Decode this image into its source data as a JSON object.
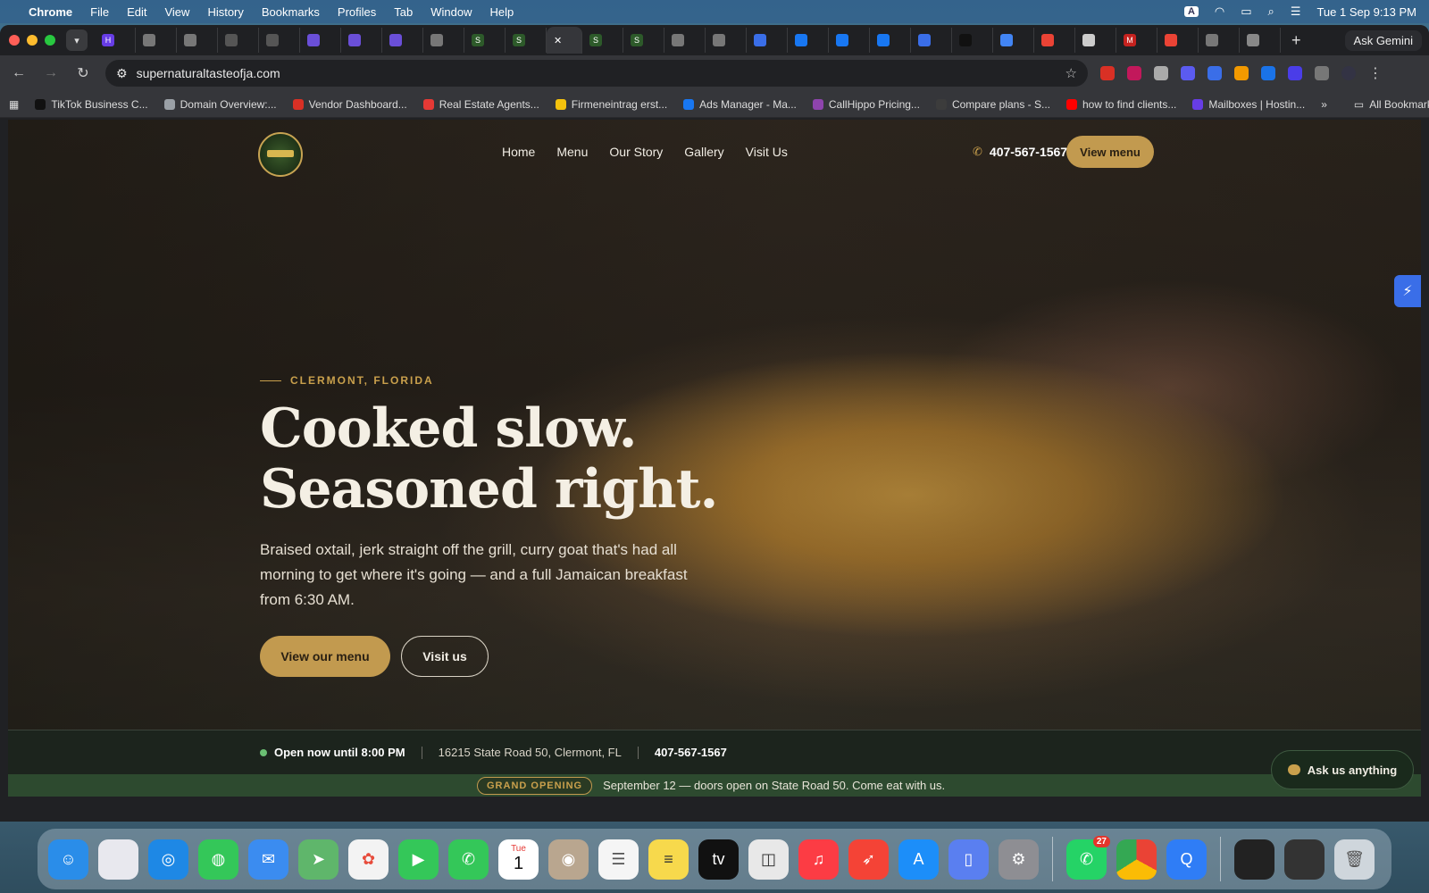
{
  "menubar": {
    "app": "Chrome",
    "items": [
      "File",
      "Edit",
      "View",
      "History",
      "Bookmarks",
      "Profiles",
      "Tab",
      "Window",
      "Help"
    ],
    "input_source": "A",
    "datetime": "Tue 1 Sep  9:13 PM"
  },
  "browser": {
    "tab_count": 30,
    "ask_gemini": "Ask Gemini",
    "url": "supernaturaltasteofja.com",
    "bookmarks": [
      {
        "label": "TikTok Business C...",
        "color": "#111111"
      },
      {
        "label": "Domain Overview:...",
        "color": "#9aa0a6"
      },
      {
        "label": "Vendor Dashboard...",
        "color": "#d93025"
      },
      {
        "label": "Real Estate Agents...",
        "color": "#e53935"
      },
      {
        "label": "Firmeneintrag erst...",
        "color": "#f4c20d"
      },
      {
        "label": "Ads Manager - Ma...",
        "color": "#1877f2"
      },
      {
        "label": "CallHippo Pricing...",
        "color": "#8e44ad"
      },
      {
        "label": "Compare plans - S...",
        "color": "#3c3c3c"
      },
      {
        "label": "how to find clients...",
        "color": "#ff0000"
      },
      {
        "label": "Mailboxes | Hostin...",
        "color": "#673de6"
      }
    ],
    "all_bookmarks": "All Bookmarks",
    "more": "»"
  },
  "site": {
    "nav": [
      "Home",
      "Menu",
      "Our Story",
      "Gallery",
      "Visit Us"
    ],
    "phone": "407-567-1567",
    "nav_cta": "View menu",
    "eyebrow": "CLERMONT, FLORIDA",
    "headline_1": "Cooked slow.",
    "headline_2": "Seasoned right.",
    "lede": "Braised oxtail, jerk straight off the grill, curry goat that's had all morning to get where it's going — and a full Jamaican breakfast from 6:30 AM.",
    "cta_primary": "View our menu",
    "cta_secondary": "Visit us",
    "info": {
      "open": "Open now until 8:00 PM",
      "address": "16215 State Road 50, Clermont, FL",
      "phone": "407-567-1567"
    },
    "announce": {
      "badge": "GRAND OPENING",
      "text": "September 12 — doors open on State Road 50. Come eat with us."
    },
    "chat": "Ask us anything"
  },
  "dock": {
    "whatsapp_badge": "27",
    "calendar_day": "1",
    "calendar_month": "Tue"
  }
}
